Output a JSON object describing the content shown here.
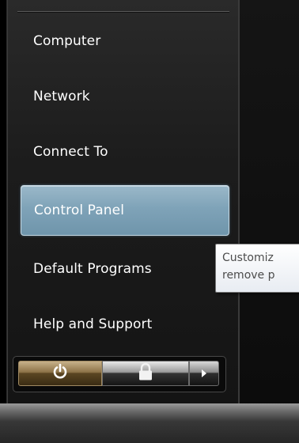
{
  "menu": {
    "items": [
      {
        "label": "Computer"
      },
      {
        "label": "Network"
      },
      {
        "label": "Connect To"
      },
      {
        "label": "Control Panel",
        "highlighted": true
      },
      {
        "label": "Default Programs"
      },
      {
        "label": "Help and Support"
      }
    ]
  },
  "tooltip": {
    "line1": "Customiz",
    "line2": "remove p"
  },
  "power_bar": {
    "power_icon": "power-icon",
    "lock_icon": "lock-icon",
    "arrow_icon": "arrow-right-icon"
  },
  "colors": {
    "highlight": "#7fa3b8",
    "menu_bg": "#1c1c1c",
    "text": "#ffffff"
  }
}
